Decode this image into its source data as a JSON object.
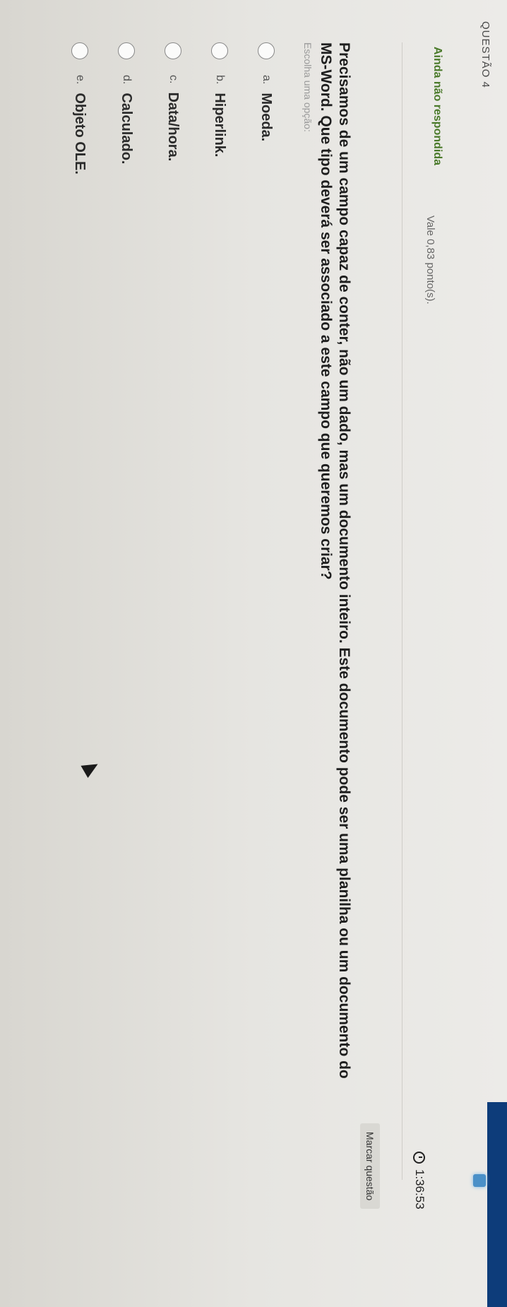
{
  "question": {
    "label": "QUESTÃO 4",
    "status": "Ainda não respondida",
    "points": "Vale 0,83 ponto(s).",
    "timer": "1:36:53",
    "mark_button": "Marcar questão",
    "text": "Precisamos de um campo capaz de conter, não um dado, mas um documento inteiro. Este documento pode ser uma planilha ou um documento do MS-Word. Que tipo deverá ser associado a este campo que queremos criar?",
    "hint": "Escolha uma opção:"
  },
  "options": [
    {
      "letter": "a.",
      "text": "Moeda."
    },
    {
      "letter": "b.",
      "text": "Hiperlink."
    },
    {
      "letter": "c.",
      "text": "Data/hora."
    },
    {
      "letter": "d.",
      "text": "Calculado."
    },
    {
      "letter": "e.",
      "text": "Objeto OLE."
    }
  ],
  "icons": {
    "timer": "clock-icon",
    "cursor": "mouse-pointer-icon",
    "taskbar": "windows-logo-icon"
  },
  "colors": {
    "status": "#4a7a2a",
    "background": "#e6e5e1",
    "taskbar": "#0d3c7a"
  }
}
